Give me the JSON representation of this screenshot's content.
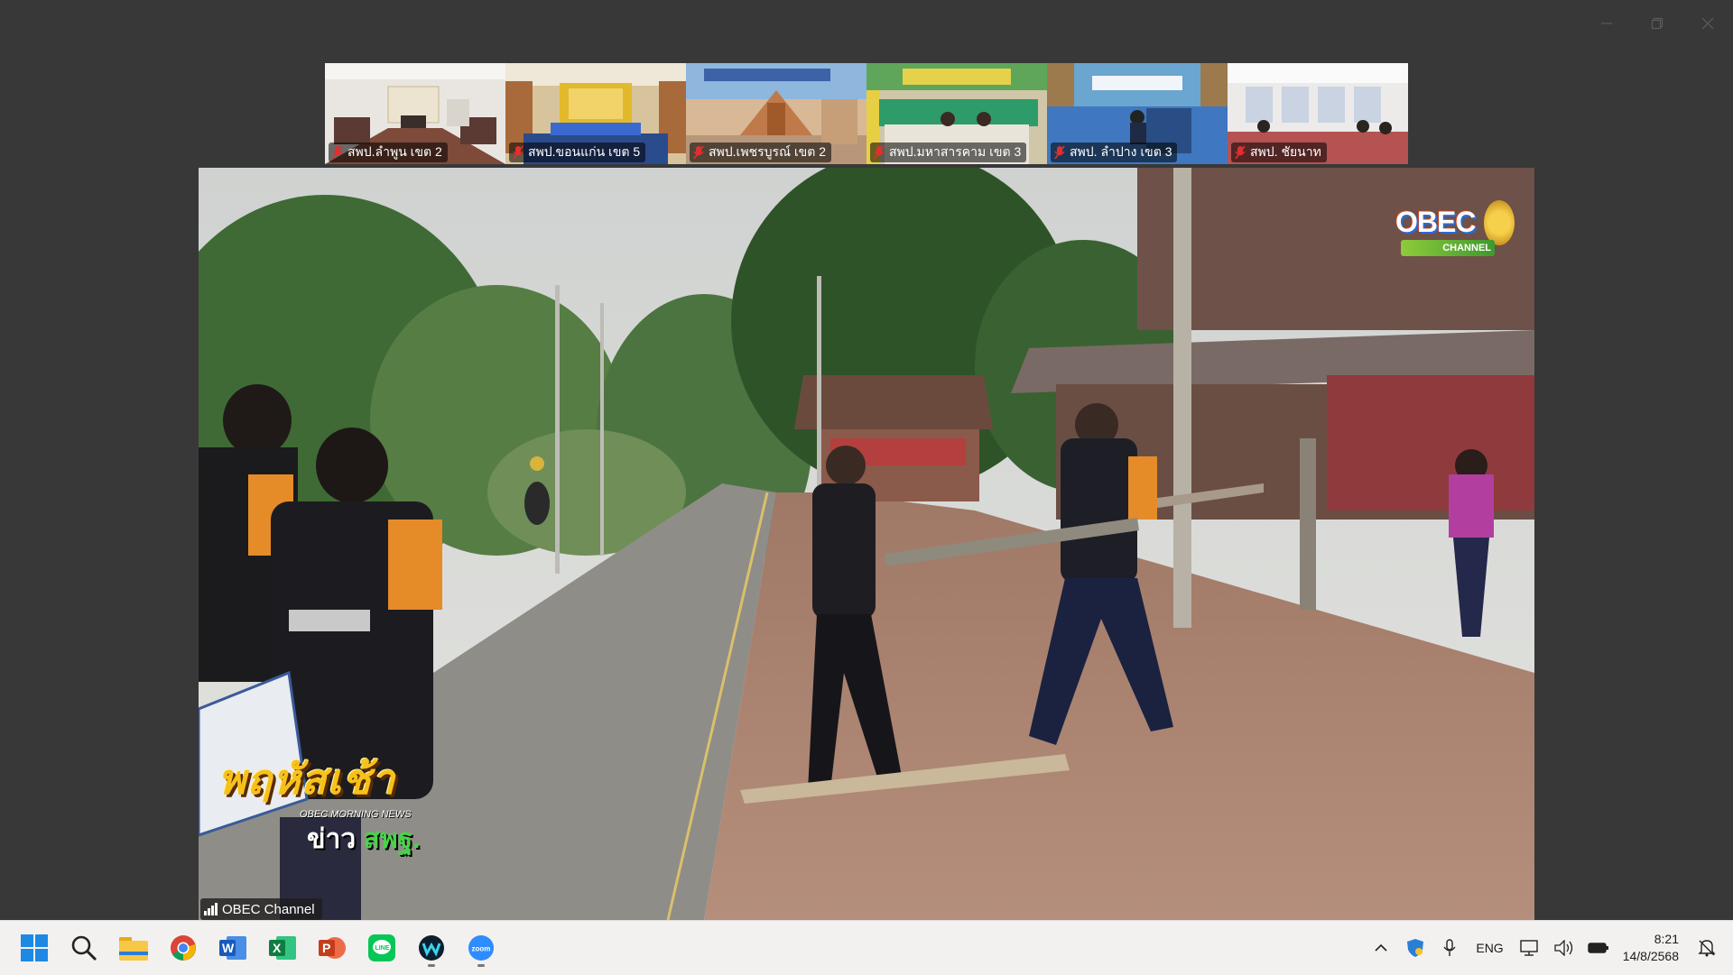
{
  "window": {
    "controls": [
      "minimize-icon",
      "restore-icon",
      "close-icon"
    ]
  },
  "gallery": [
    {
      "name": "สพป.ลำพูน เขต 2",
      "muted": true,
      "scene": "conference-room"
    },
    {
      "name": "สพป.ขอนแก่น เขต 5",
      "muted": true,
      "scene": "auditorium"
    },
    {
      "name": "สพป.เพชรบูรณ์ เขต 2",
      "muted": true,
      "scene": "virtual-background"
    },
    {
      "name": "สพป.มหาสารคาม เขต 3",
      "muted": true,
      "scene": "meeting-room-green"
    },
    {
      "name": "สพป. ลำปาง เขต 3",
      "muted": true,
      "scene": "stage-blue"
    },
    {
      "name": "สพป. ชัยนาท",
      "muted": true,
      "scene": "office-room"
    }
  ],
  "video": {
    "logo": {
      "text": "OBEC",
      "sub": "CHANNEL"
    },
    "show": {
      "title": "พฤหัสเช้า",
      "subtitle": "OBEC MORNING NEWS",
      "news_prefix": "ข่าว",
      "news_brand": "สพฐ."
    },
    "participant_label": "OBEC Channel"
  },
  "taskbar": {
    "apps": [
      "windows-start-icon",
      "search-icon",
      "file-explorer-icon",
      "chrome-icon",
      "word-icon",
      "excel-icon",
      "powerpoint-icon",
      "line-icon",
      "webex-icon",
      "zoom-icon"
    ],
    "language": "ENG",
    "time": "8:21",
    "date": "14/8/2568"
  },
  "colors": {
    "background": "#383838",
    "taskbar": "#f2f1ef",
    "show_title": "#f6c11a",
    "mute_red": "#e03030"
  }
}
